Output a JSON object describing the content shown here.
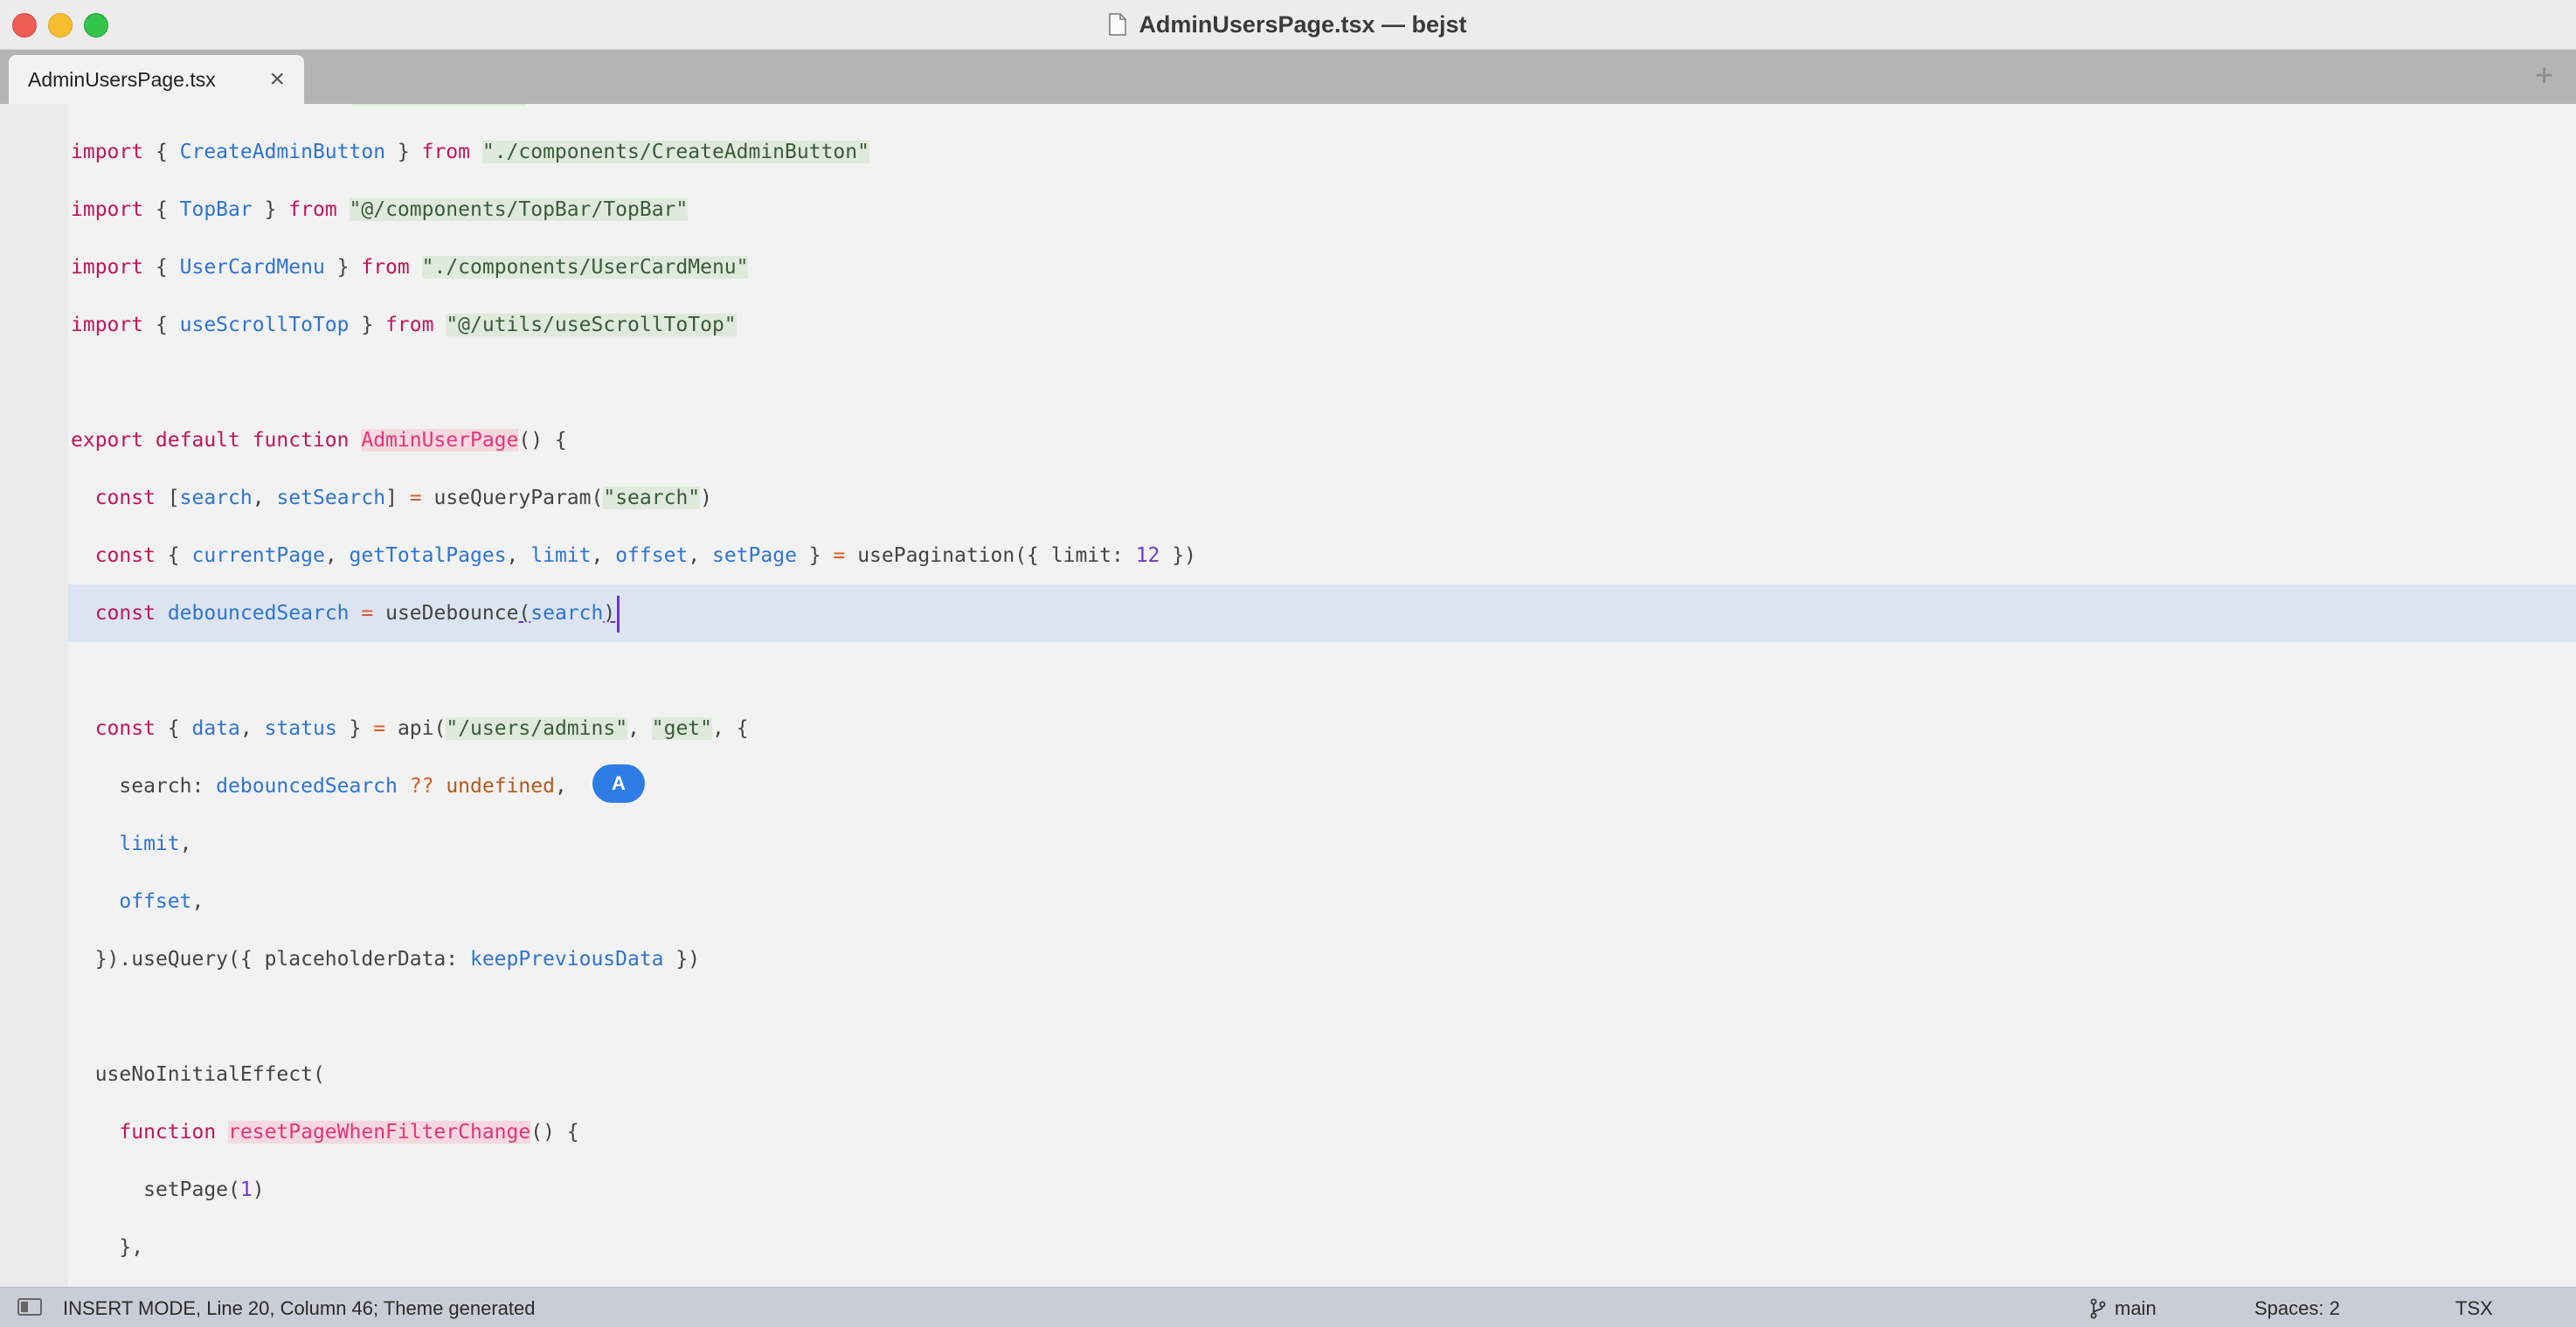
{
  "window": {
    "title": "AdminUsersPage.tsx — bejst"
  },
  "tabs": [
    {
      "label": "AdminUsersPage.tsx",
      "close_symbol": "×"
    }
  ],
  "tab_add_symbol": "+",
  "code": {
    "l1": {
      "kw": "import",
      "p1": " { ",
      "name": "CreateAdminButton",
      "p2": " } ",
      "kw2": "from",
      "sp": " ",
      "str": "\"./components/CreateAdminButton\""
    },
    "l2": {
      "kw": "import",
      "p1": " { ",
      "name": "TopBar",
      "p2": " } ",
      "kw2": "from",
      "sp": " ",
      "str": "\"@/components/TopBar/TopBar\""
    },
    "l3": {
      "kw": "import",
      "p1": " { ",
      "name": "UserCardMenu",
      "p2": " } ",
      "kw2": "from",
      "sp": " ",
      "str": "\"./components/UserCardMenu\""
    },
    "l4": {
      "kw": "import",
      "p1": " { ",
      "name": "useScrollToTop",
      "p2": " } ",
      "kw2": "from",
      "sp": " ",
      "str": "\"@/utils/useScrollToTop\""
    },
    "l5": {
      "kw": "export default function",
      "sp": " ",
      "fn": "AdminUserPage",
      "rest": "() {"
    },
    "l6": {
      "indent": "  ",
      "kw": "const",
      "p1": " [",
      "a": "search",
      "c": ", ",
      "b": "setSearch",
      "p2": "] ",
      "eq": "=",
      "p3": " useQueryParam(",
      "str": "\"search\"",
      "p4": ")"
    },
    "l7": {
      "indent": "  ",
      "kw": "const",
      "p1": " { ",
      "a": "currentPage",
      "c1": ", ",
      "b": "getTotalPages",
      "c2": ", ",
      "c": "limit",
      "c3": ", ",
      "d": "offset",
      "c4": ", ",
      "e": "setPage",
      "p2": " } ",
      "eq": "=",
      "p3": " usePagination({ limit: ",
      "num": "12",
      "p4": " })"
    },
    "l8": {
      "indent": "  ",
      "kw": "const",
      "sp": " ",
      "a": "debouncedSearch",
      "sp2": " ",
      "eq": "=",
      "p1": " useDebounce",
      "paren": "(",
      "arg": "search",
      "close": ")"
    },
    "l9": {
      "indent": "  ",
      "kw": "const",
      "p1": " { ",
      "a": "data",
      "c": ", ",
      "b": "status",
      "p2": " } ",
      "eq": "=",
      "p3": " api(",
      "str1": "\"/users/admins\"",
      "c2": ", ",
      "str2": "\"get\"",
      "p4": ", {"
    },
    "l10": {
      "indent": "    ",
      "p1": "search: ",
      "a": "debouncedSearch",
      "sp": " ",
      "op": "??",
      "sp2": " ",
      "u": "undefined",
      "p2": ","
    },
    "l11": {
      "indent": "    ",
      "a": "limit",
      "p": ","
    },
    "l12": {
      "indent": "    ",
      "a": "offset",
      "p": ","
    },
    "l13": {
      "indent": "  ",
      "p1": "}).useQuery({ placeholderData: ",
      "a": "keepPreviousData",
      "p2": " })"
    },
    "l14": {
      "indent": "  ",
      "p": "useNoInitialEffect("
    },
    "l15": {
      "indent": "    ",
      "kw": "function",
      "sp": " ",
      "fn": "resetPageWhenFilterChange",
      "rest": "() {"
    },
    "l16": {
      "indent": "      ",
      "p1": "setPage(",
      "num": "1",
      "p2": ")"
    },
    "l17": {
      "indent": "    ",
      "p": "},"
    }
  },
  "badge_letter": "A",
  "statusbar": {
    "mode": "INSERT MODE, Line 20, Column 46; Theme generated",
    "branch": "main",
    "spaces": "Spaces: 2",
    "syntax": "TSX"
  }
}
